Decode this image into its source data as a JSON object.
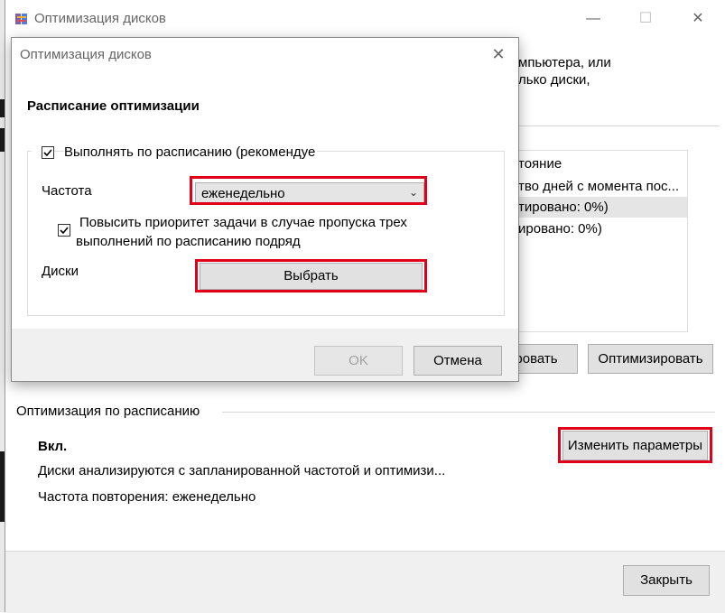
{
  "main_window": {
    "title": "Оптимизация дисков",
    "controls": {
      "minimize": "—",
      "maximize": "☐",
      "close": "✕"
    },
    "partial_text_line1": "мпьютера, или",
    "partial_text_line2": "лько диски,",
    "list": {
      "header": "тояние",
      "rows": [
        "тво дней с момента пос...",
        "тировано: 0%)",
        "ировано: 0%)"
      ]
    },
    "analyze_button_partial": "ровать",
    "optimize_button": "Оптимизировать",
    "scheduled": {
      "section_label": "Оптимизация по расписанию",
      "state": "Вкл.",
      "description": "Диски анализируются с запланированной частотой и оптимизи...",
      "frequency": "Частота повторения: еженедельно",
      "change_button": "Изменить параметры"
    },
    "close_button": "Закрыть"
  },
  "dialog": {
    "title": "Оптимизация дисков",
    "close": "✕",
    "heading": "Расписание оптимизации",
    "run_on_schedule": {
      "label": "Выполнять по расписанию (рекомендуе",
      "checked": true
    },
    "frequency_label": "Частота",
    "frequency_value": "еженедельно",
    "priority": {
      "line1": "Повысить приоритет задачи в случае пропуска трех",
      "line2": "выполнений по расписанию подряд",
      "checked": true
    },
    "drives_label": "Диски",
    "choose_button": "Выбрать",
    "ok_button": "OK",
    "cancel_button": "Отмена"
  },
  "colors": {
    "highlight": "#e0001a",
    "button_face": "#e1e1e1",
    "footer": "#f0f0f0"
  }
}
